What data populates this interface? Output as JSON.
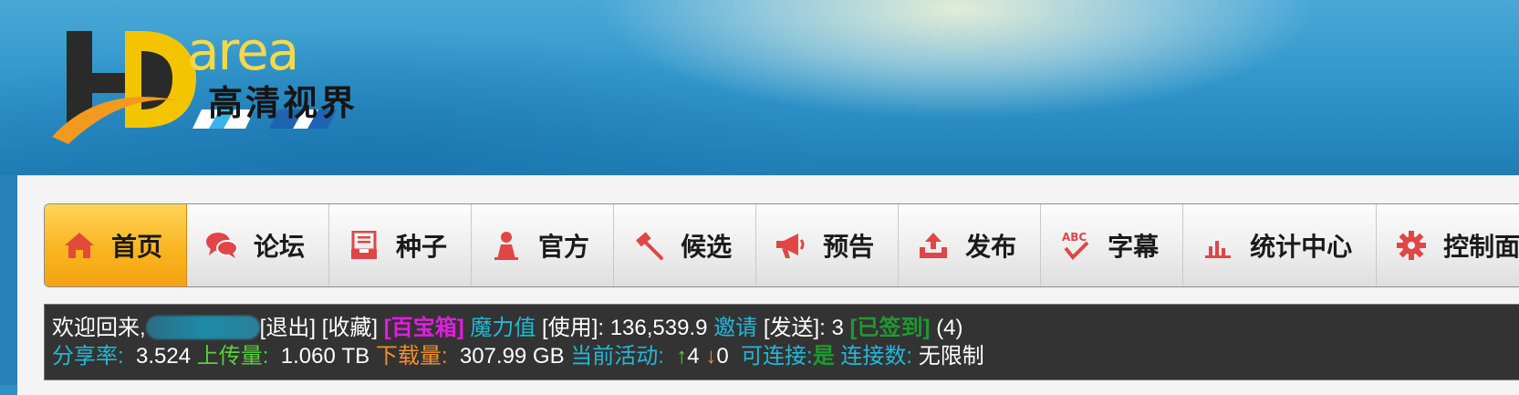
{
  "logo": {
    "text": "高清视界",
    "letters": "area"
  },
  "nav": {
    "items": [
      {
        "label": "首页",
        "icon": "home-icon",
        "active": true
      },
      {
        "label": "论坛",
        "icon": "chat-bubbles-icon"
      },
      {
        "label": "种子",
        "icon": "inbox-icon"
      },
      {
        "label": "官方",
        "icon": "user-icon"
      },
      {
        "label": "候选",
        "icon": "gavel-icon"
      },
      {
        "label": "预告",
        "icon": "megaphone-icon"
      },
      {
        "label": "发布",
        "icon": "upload-icon"
      },
      {
        "label": "字幕",
        "icon": "abc-check-icon"
      },
      {
        "label": "统计中心",
        "icon": "bar-chart-icon"
      },
      {
        "label": "控制面板",
        "icon": "gear-icon"
      }
    ],
    "accent": "#f9b520",
    "icon_color": "#e04646"
  },
  "user": {
    "welcome": "欢迎回来,",
    "logout": "[退出]",
    "favorites": "[收藏]",
    "treasure": "[百宝箱]",
    "bonus_label": "魔力值",
    "bonus_use": "[使用]",
    "bonus_value": ": 136,539.9",
    "invite_label": "邀请",
    "invite_send": "[发送]",
    "invite_value": ": 3",
    "signed": "[已签到]",
    "signed_count": "(4)",
    "ratio_label": "分享率:",
    "ratio_value": "3.524",
    "upload_label": "上传量:",
    "upload_value": "1.060 TB",
    "download_label": "下载量:",
    "download_value": "307.99 GB",
    "active_label": "当前活动:",
    "seeding_count": "4",
    "leeching_count": "0",
    "connectable_label": "可连接:",
    "connectable_value": "是",
    "connections_label": "连接数:",
    "connections_value": "无限制"
  }
}
